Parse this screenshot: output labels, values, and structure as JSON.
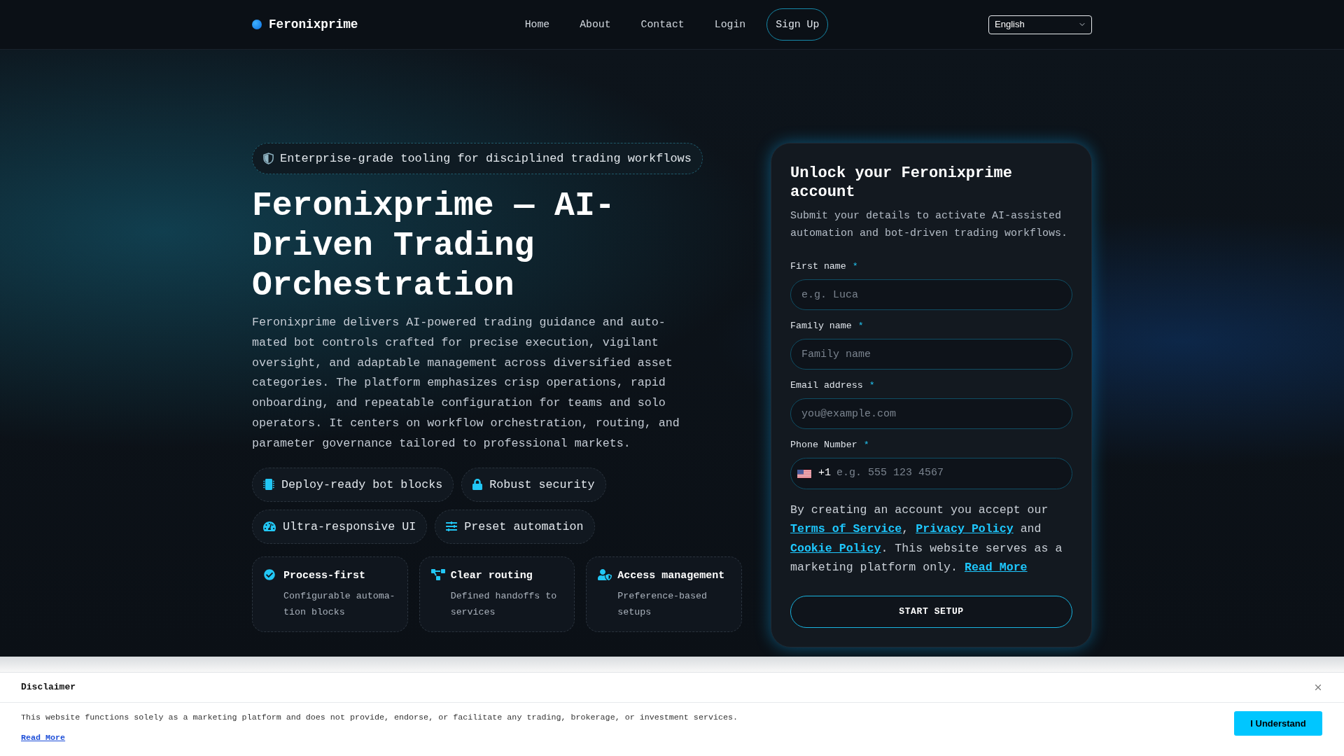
{
  "nav": {
    "brand": "Feronixprime",
    "links": [
      {
        "label": "Home"
      },
      {
        "label": "About"
      },
      {
        "label": "Contact"
      },
      {
        "label": "Login"
      }
    ],
    "signup_button": "Sign Up",
    "language_select": {
      "value": "English"
    }
  },
  "hero": {
    "badge": "Enterprise-grade tooling for disciplined trading workflows",
    "title": "Feronixprime — AI-Driven Trading Orchestration",
    "description": "Feronixprime delivers AI-powered trading guidance and auto-mated bot controls crafted for precise execution, vigilant oversight, and adaptable management across diversified asset categories. The platform emphasizes crisp operations, rapid onboarding, and repeatable configuration for teams and solo operators. It centers on workflow orchestration, routing, and parameter governance tailored to professional markets.",
    "features": [
      {
        "label": "Deploy-ready bot blocks"
      },
      {
        "label": "Robust security"
      },
      {
        "label": "Ultra-responsive UI"
      },
      {
        "label": "Preset automation"
      }
    ],
    "cards": [
      {
        "title": "Process-first",
        "description": "Configurable automa-tion blocks"
      },
      {
        "title": "Clear routing",
        "description": "Defined handoffs to services"
      },
      {
        "title": "Access management",
        "description": "Preference-based setups"
      }
    ]
  },
  "signup_form": {
    "title": "Unlock your Feronixprime account",
    "subtitle": "Submit your details to activate AI-assisted automation and bot-driven trading workflows.",
    "fields": [
      {
        "kind": "text",
        "label": "First name",
        "required_mark": "*",
        "placeholder": "e.g. Luca"
      },
      {
        "kind": "text",
        "label": "Family name",
        "required_mark": "*",
        "placeholder": "Family name"
      },
      {
        "kind": "email",
        "label": "Email address",
        "required_mark": "*",
        "placeholder": "you@example.com"
      },
      {
        "kind": "phone",
        "label": "Phone Number",
        "required_mark": "*",
        "country_code": "+1",
        "placeholder": "e.g. 555 123 4567"
      }
    ],
    "consent": [
      {
        "kind": "text",
        "text": "By creating an account you accept our "
      },
      {
        "kind": "link",
        "text": "Terms of Service"
      },
      {
        "kind": "text",
        "text": ", "
      },
      {
        "kind": "link",
        "text": "Privacy Policy"
      },
      {
        "kind": "text",
        "text": " and "
      },
      {
        "kind": "link",
        "text": "Cookie Policy"
      },
      {
        "kind": "text",
        "text": ". This website serves as a marketing platform only. "
      },
      {
        "kind": "link",
        "text": "Read More"
      }
    ],
    "submit_button": "START SETUP"
  },
  "disclaimer": {
    "title": "Disclaimer",
    "text": "This website functions solely as a marketing platform and does not provide, endorse, or facilitate any trading, brokerage, or investment services.",
    "link": "Read More",
    "button": "I Understand"
  }
}
